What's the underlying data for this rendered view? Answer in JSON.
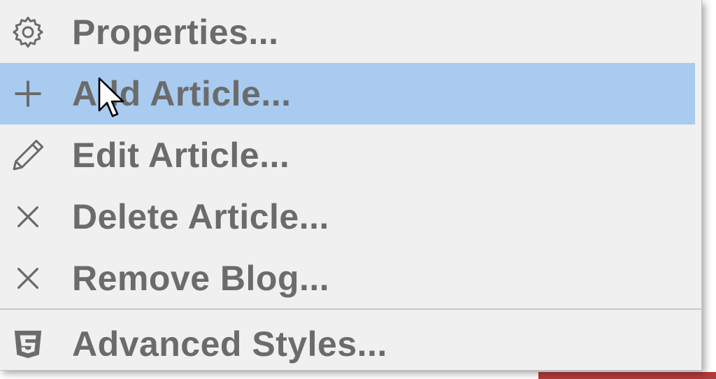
{
  "context_menu": {
    "items": [
      {
        "label": "Properties...",
        "icon": "gear-icon"
      },
      {
        "label": "Add Article...",
        "icon": "plus-icon",
        "highlighted": true
      },
      {
        "label": "Edit Article...",
        "icon": "pencil-icon"
      },
      {
        "label": "Delete Article...",
        "icon": "close-icon"
      },
      {
        "label": "Remove Blog...",
        "icon": "close-icon"
      },
      {
        "label": "Advanced Styles...",
        "icon": "css3-icon"
      }
    ]
  },
  "colors": {
    "menu_background": "#f0f0f0",
    "highlight": "#a8cbef",
    "text": "#6b6b6b",
    "separator": "#c8c8c8"
  }
}
